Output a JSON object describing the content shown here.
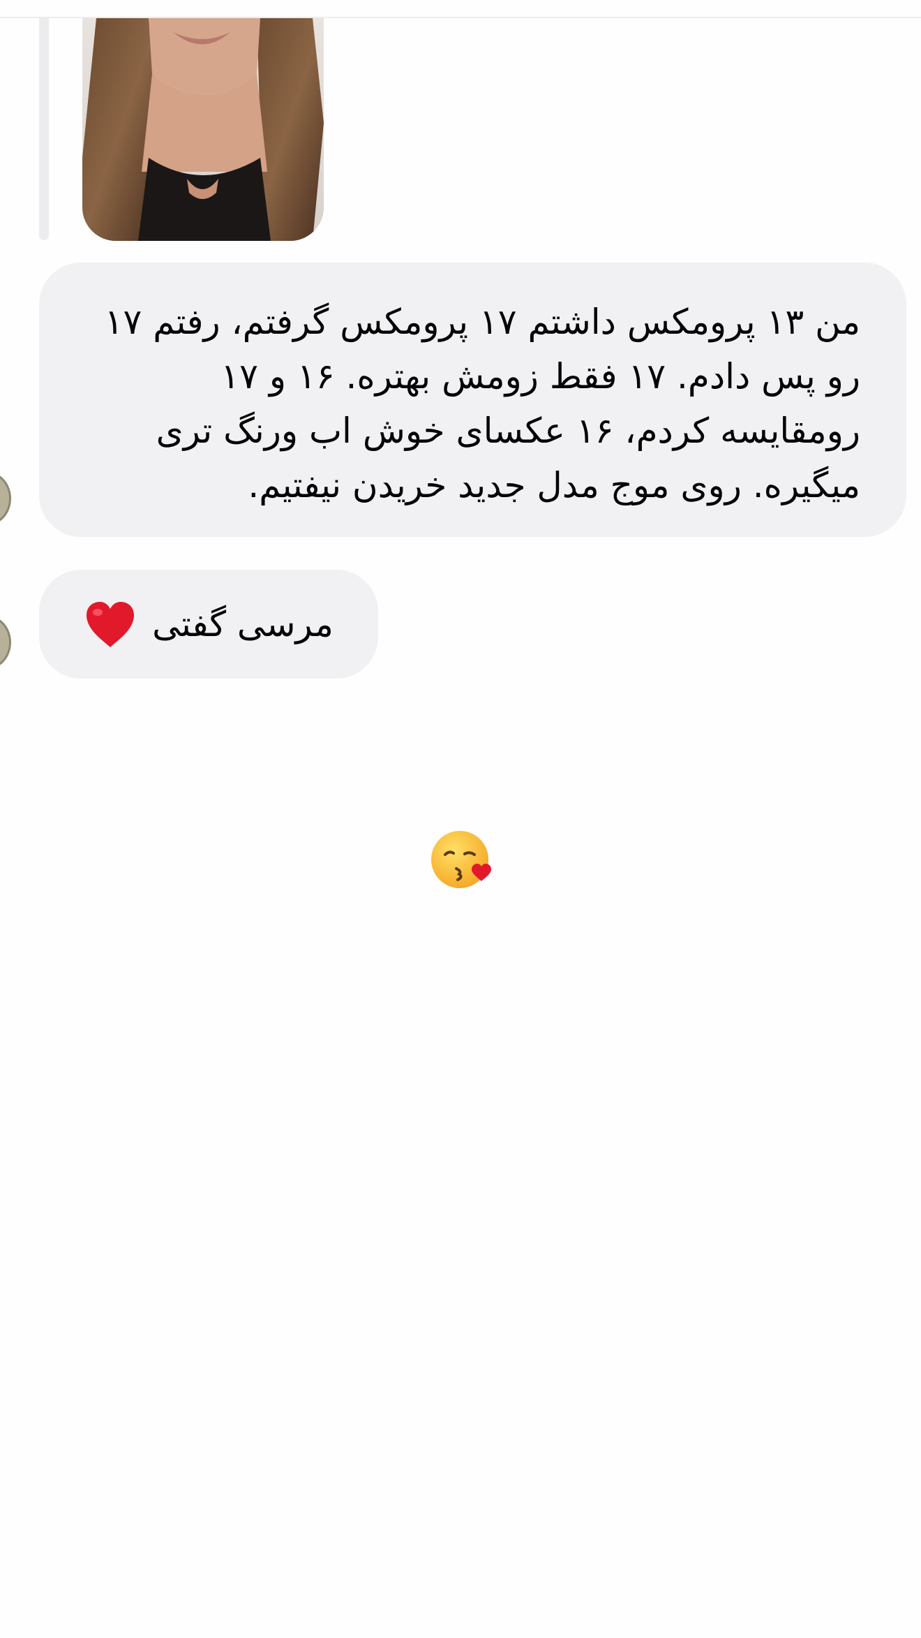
{
  "thread": {
    "reply_preview": {
      "image": "profile-photo-of-woman-with-long-brown-hair-black-top"
    },
    "messages": [
      {
        "text": "من ۱۳ پرومکس داشتم ۱۷ پرومکس گرفتم، رفتم ۱۷ رو پس دادم. ۱۷ فقط زومش بهتره. ۱۶ و ۱۷ رومقایسه کردم، ۱۶ عکسای خوش اب ورنگ تری میگیره. روی موج مدل جدید خریدن نیفتیم.",
        "has_avatar": true
      },
      {
        "text": "مرسی گفتی",
        "trailing_icon": "red-heart-icon",
        "has_avatar": true
      }
    ],
    "reaction_emoji": "face-blowing-a-kiss-icon"
  },
  "colors": {
    "background": "#fefefe",
    "bubble": "#f1f1f3",
    "divider": "#ececee",
    "heart": "#e2192b",
    "text": "#050505"
  }
}
